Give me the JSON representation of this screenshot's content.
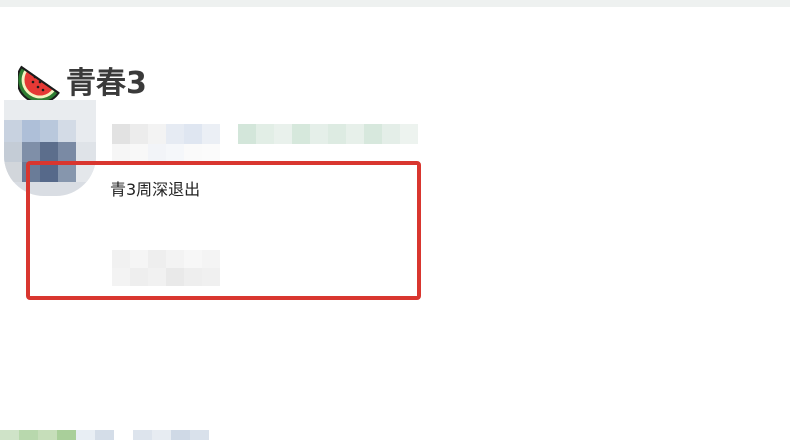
{
  "group": {
    "icon": "watermelon-icon",
    "title": "青春3"
  },
  "post": {
    "author_avatar": "avatar",
    "text": "青3周深退出"
  },
  "colors": {
    "highlight_border": "#d9362f",
    "title_text": "#3a3a3a",
    "body_text": "#222222"
  }
}
